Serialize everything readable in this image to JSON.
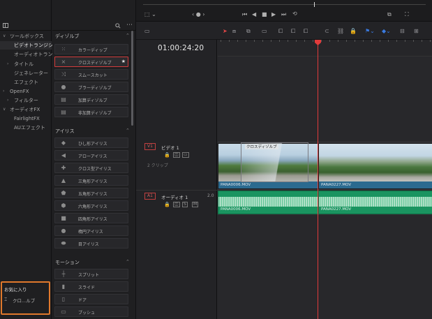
{
  "tree": {
    "items": [
      {
        "label": "ツールボックス",
        "expanded": true,
        "level": 0
      },
      {
        "label": "ビデオトランジシ",
        "level": 1,
        "selected": true
      },
      {
        "label": "オーディオトラン..",
        "level": 1
      },
      {
        "label": "タイトル",
        "level": 1,
        "collapsed": true
      },
      {
        "label": "ジェネレーター",
        "level": 1
      },
      {
        "label": "エフェクト",
        "level": 1
      },
      {
        "label": "OpenFX",
        "level": 0,
        "collapsed": true
      },
      {
        "label": "フィルター",
        "level": 1,
        "collapsed": true
      },
      {
        "label": "オーディオFX",
        "level": 0,
        "expanded": true
      },
      {
        "label": "FairlightFX",
        "level": 1
      },
      {
        "label": "AUエフェクト",
        "level": 1
      }
    ],
    "favorites": {
      "title": "お気に入り",
      "item_label": "クロ...ルブ"
    }
  },
  "effects": {
    "sections": [
      {
        "title": "ディゾルブ",
        "items": [
          {
            "label": "カラーディップ",
            "icon": "dots-icon"
          },
          {
            "label": "クロスディゾルブ",
            "icon": "crossfade-icon",
            "selected": true,
            "favorite": true
          },
          {
            "label": "スムースカット",
            "icon": "smooth-cut-icon"
          },
          {
            "label": "ブラーディゾルブ",
            "icon": "drop-icon"
          },
          {
            "label": "加算ディゾルブ",
            "icon": "stack-icon"
          },
          {
            "label": "非加算ディゾルブ",
            "icon": "stack-icon"
          }
        ]
      },
      {
        "title": "アイリス",
        "items": [
          {
            "label": "ひし形アイリス",
            "icon": "diamond-shape"
          },
          {
            "label": "アローアイリス",
            "icon": "arrow-shape"
          },
          {
            "label": "クロス型アイリス",
            "icon": "cross-shape"
          },
          {
            "label": "三角形アイリス",
            "icon": "triangle-shape"
          },
          {
            "label": "五角形アイリス",
            "icon": "pentagon-shape"
          },
          {
            "label": "六角形アイリス",
            "icon": "hexagon-shape"
          },
          {
            "label": "四角形アイリス",
            "icon": "square-shape"
          },
          {
            "label": "楕円アイリス",
            "icon": "circle-shape"
          },
          {
            "label": "目アイリス",
            "icon": "eye-shape"
          }
        ]
      },
      {
        "title": "モーション",
        "items": [
          {
            "label": "スプリット",
            "icon": "split-shape"
          },
          {
            "label": "スライド",
            "icon": "slide-shape"
          },
          {
            "label": "ドア",
            "icon": "door-shape"
          },
          {
            "label": "プッシュ",
            "icon": "push-shape"
          }
        ]
      }
    ],
    "star_glyph": "★"
  },
  "timeline": {
    "timecode": "01:00:24:20",
    "video_track": {
      "tag": "V1",
      "name": "ビデオ 1",
      "clip_count": "2 クリップ"
    },
    "audio_track": {
      "tag": "A1",
      "name": "オーディオ 1",
      "level": "2.0",
      "solo": "S",
      "mute": "M"
    },
    "video_clips": [
      {
        "name": "PANA0006.MOV"
      },
      {
        "name": "PANA0227.MOV"
      }
    ],
    "audio_clips": [
      {
        "name": "PANA0006.MOV"
      },
      {
        "name": "PANA0227.MOV"
      }
    ],
    "transition_label": "クロスディゾルブ",
    "colors": {
      "playhead": "#e23b3b",
      "audio_clip": "#1a9460",
      "video_label": "#2b6a8f",
      "favorites_border": "#e0782c"
    }
  }
}
